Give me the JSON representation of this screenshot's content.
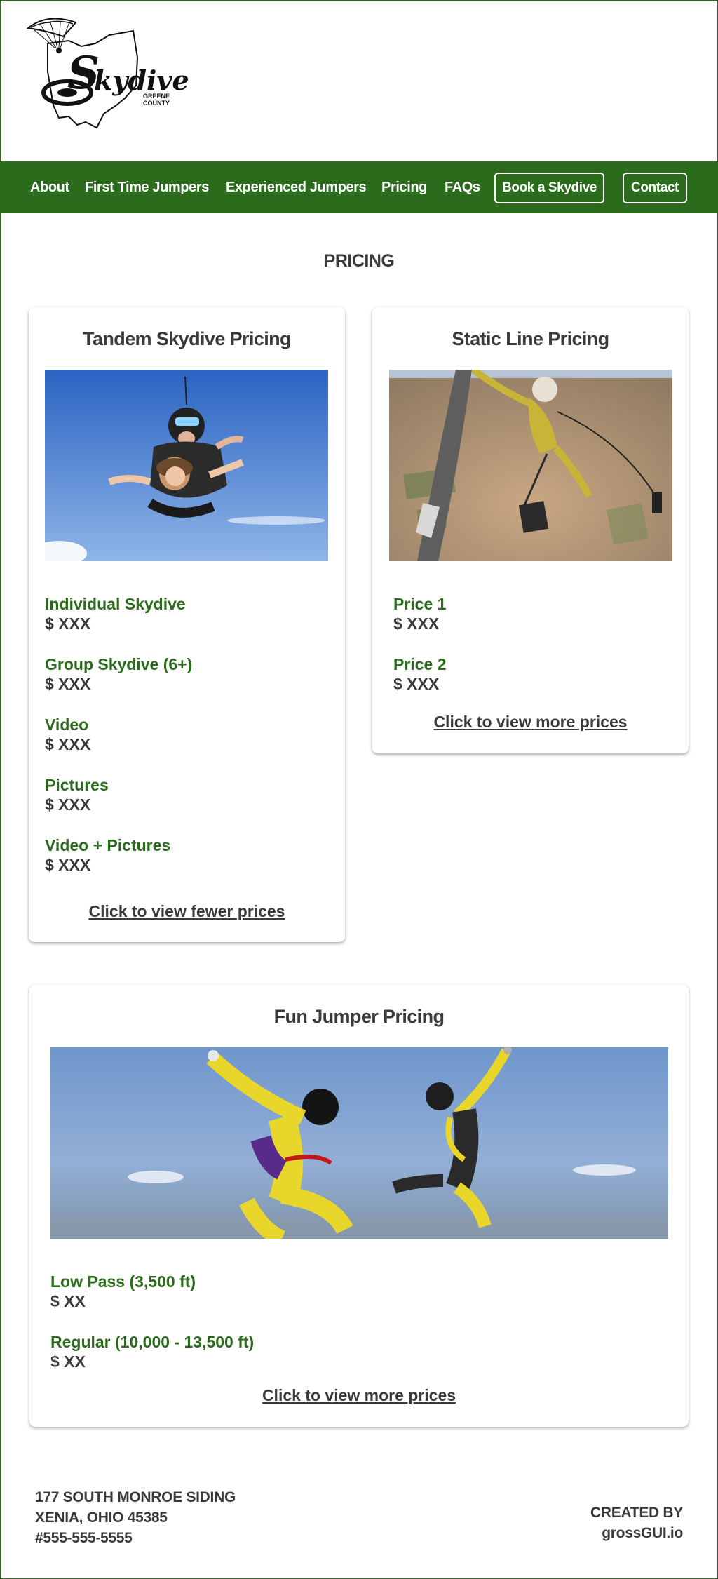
{
  "logo": {
    "name": "Skydive",
    "sub_line1": "GREENE",
    "sub_line2": "COUNTY"
  },
  "nav": {
    "items": [
      "About",
      "First Time Jumpers",
      "Experienced Jumpers",
      "Pricing",
      "FAQs"
    ],
    "book_button": "Book a Skydive",
    "contact_button": "Contact"
  },
  "page_title": "PRICING",
  "tandem": {
    "title": "Tandem Skydive Pricing",
    "image_icon": "tandem-skydivers-photo",
    "prices": [
      {
        "name": "Individual Skydive",
        "value": "$ XXX"
      },
      {
        "name": "Group Skydive (6+)",
        "value": "$ XXX"
      },
      {
        "name": "Video",
        "value": "$ XXX"
      },
      {
        "name": "Pictures",
        "value": "$ XXX"
      },
      {
        "name": "Video + Pictures",
        "value": "$ XXX"
      }
    ],
    "link": "Click to view fewer prices"
  },
  "static_line": {
    "title": "Static Line Pricing",
    "image_icon": "static-line-jumper-photo",
    "prices": [
      {
        "name": "Price 1",
        "value": "$ XXX"
      },
      {
        "name": "Price 2",
        "value": "$ XXX"
      }
    ],
    "link": "Click to view more prices"
  },
  "fun_jumper": {
    "title": "Fun Jumper Pricing",
    "image_icon": "formation-skydivers-photo",
    "prices": [
      {
        "name": "Low Pass (3,500 ft)",
        "value": "$ XX"
      },
      {
        "name": "Regular (10,000 - 13,500 ft)",
        "value": "$ XX"
      }
    ],
    "link": "Click to view more prices"
  },
  "footer": {
    "address_line1": "177 SOUTH MONROE SIDING",
    "address_line2": "XENIA, OHIO 45385",
    "phone": "#555-555-5555",
    "credit_line1": "CREATED BY",
    "credit_line2": "grossGUI.io"
  },
  "colors": {
    "brand_green": "#2a6b1c",
    "text_dark": "#3a3a3a",
    "background": "#ffffff"
  }
}
